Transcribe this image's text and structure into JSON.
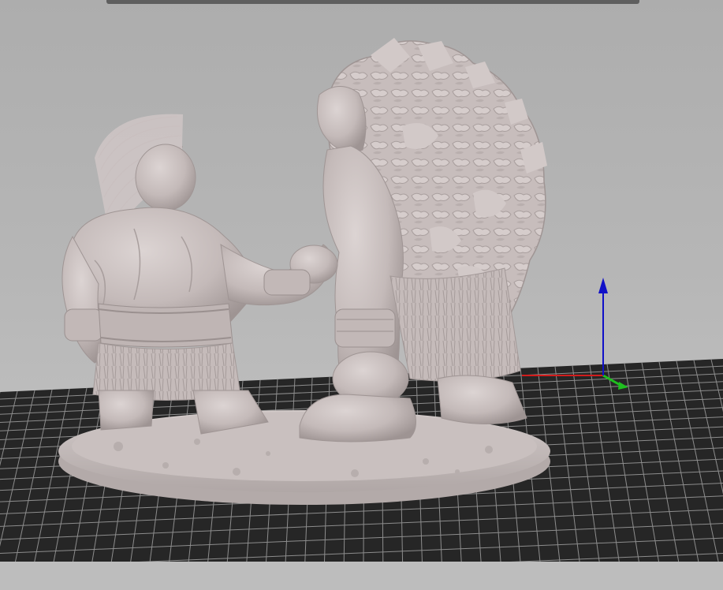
{
  "viewer": {
    "background": "#b4b4b4",
    "bed_surface": "#262626",
    "bed_grid_line": "#8d8d8d",
    "model_color": "#c7bdbc"
  },
  "toolbar": {
    "color": "#5f5f5f"
  },
  "axes": {
    "x_color": "#d21d1d",
    "y_color": "#1fbf1f",
    "z_color": "#1010c8"
  },
  "model": {
    "subject": "dwarf-and-rock-golem-handshake-miniature"
  }
}
